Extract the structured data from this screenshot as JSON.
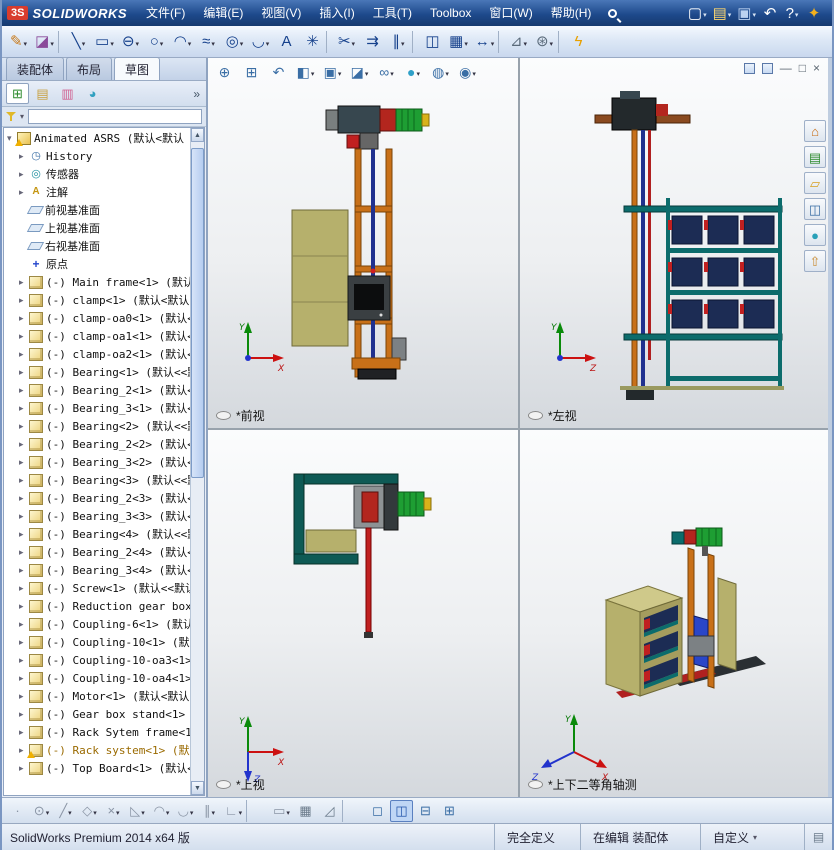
{
  "title_bar": {
    "logo_mark": "3S",
    "logo_text": "SOLIDWORKS",
    "menus": [
      {
        "name": "menu-file",
        "label": "文件(F)"
      },
      {
        "name": "menu-edit",
        "label": "编辑(E)"
      },
      {
        "name": "menu-view",
        "label": "视图(V)"
      },
      {
        "name": "menu-insert",
        "label": "插入(I)"
      },
      {
        "name": "menu-tools",
        "label": "工具(T)"
      },
      {
        "name": "menu-toolbox",
        "label": "Toolbox"
      },
      {
        "name": "menu-window",
        "label": "窗口(W)"
      },
      {
        "name": "menu-help",
        "label": "帮助(H)"
      }
    ],
    "icons": [
      {
        "name": "new-document-button",
        "glyph": "▢",
        "color": "#ffffff",
        "dd": true
      },
      {
        "name": "open-button",
        "glyph": "▤",
        "color": "#ffd870",
        "dd": true
      },
      {
        "name": "save-button",
        "glyph": "▣",
        "color": "#bcd2f0",
        "dd": true
      },
      {
        "name": "undo-button",
        "glyph": "↶",
        "color": "#ffffff"
      },
      {
        "name": "help-button",
        "glyph": "?",
        "color": "#ffffff",
        "dd": true
      },
      {
        "name": "resources-button",
        "glyph": "✦",
        "color": "#f2b01e"
      }
    ]
  },
  "main_toolbar": [
    {
      "name": "smart-dimension-button",
      "glyph": "✎",
      "color": "#c87a1a",
      "dd": true
    },
    {
      "name": "sketch-button",
      "glyph": "◪",
      "color": "#8a4a9a",
      "dd": true
    },
    {
      "sep": true
    },
    {
      "name": "line-button",
      "glyph": "╲",
      "color": "#16418c",
      "dd": true
    },
    {
      "name": "rectangle-button",
      "glyph": "▭",
      "color": "#16418c",
      "dd": true
    },
    {
      "name": "slot-button",
      "glyph": "⊖",
      "color": "#16418c",
      "dd": true
    },
    {
      "name": "circle-button",
      "glyph": "○",
      "color": "#16418c",
      "dd": true
    },
    {
      "name": "arc-button",
      "glyph": "◠",
      "color": "#16418c",
      "dd": true
    },
    {
      "name": "spline-button",
      "glyph": "≈",
      "color": "#16418c",
      "dd": true
    },
    {
      "name": "ellipse-button",
      "glyph": "◎",
      "color": "#16418c",
      "dd": true
    },
    {
      "name": "fillet-button",
      "glyph": "◡",
      "color": "#16418c",
      "dd": true
    },
    {
      "name": "text-button",
      "glyph": "A",
      "color": "#16418c"
    },
    {
      "name": "point-button",
      "glyph": "✳",
      "color": "#16418c"
    },
    {
      "sep": true
    },
    {
      "name": "trim-entities-button",
      "glyph": "✂",
      "color": "#16418c",
      "dd": true
    },
    {
      "name": "convert-entities-button",
      "glyph": "⇉",
      "color": "#16418c"
    },
    {
      "name": "offset-entities-button",
      "glyph": "∥",
      "color": "#16418c",
      "dd": true
    },
    {
      "sep": true
    },
    {
      "name": "mirror-entities-button",
      "glyph": "◫",
      "color": "#16418c"
    },
    {
      "name": "linear-pattern-button",
      "glyph": "▦",
      "color": "#16418c",
      "dd": true
    },
    {
      "name": "move-entities-button",
      "glyph": "↔",
      "color": "#16418c",
      "dd": true
    },
    {
      "sep": true
    },
    {
      "name": "display-relations-button",
      "glyph": "⊿",
      "color": "#5a6a7a",
      "dd": true
    },
    {
      "name": "quick-snaps-button",
      "glyph": "⊛",
      "color": "#5a6a7a",
      "dd": true
    },
    {
      "sep": true
    },
    {
      "name": "instant3d-button",
      "glyph": "ϟ",
      "color": "#e8a000"
    }
  ],
  "command_tabs": [
    {
      "name": "tab-assembly",
      "label": "装配体"
    },
    {
      "name": "tab-layout",
      "label": "布局"
    },
    {
      "name": "tab-sketch",
      "label": "草图",
      "active": true
    }
  ],
  "feature_manager": {
    "chevron": "»",
    "filter_arrow": "▾",
    "tabs": [
      {
        "name": "featuremanager-tree-tab",
        "glyph": "⊞",
        "color": "#2e8b2e",
        "active": true
      },
      {
        "name": "propertymanager-tab",
        "glyph": "▤",
        "color": "#c8a040"
      },
      {
        "name": "configurationmanager-tab",
        "glyph": "▥",
        "color": "#d06090"
      },
      {
        "name": "displaymanager-tab",
        "glyph": "◕",
        "color": "#30a0c0"
      }
    ]
  },
  "feature_tree": {
    "items": [
      {
        "icon": "assembly-icon",
        "label": "Animated ASRS (默认<默认",
        "e": "▾",
        "level": 0,
        "warning": true
      },
      {
        "icon": "history-icon",
        "label": "History",
        "e": "▸",
        "level": 1
      },
      {
        "icon": "sensors-icon",
        "label": "传感器",
        "e": "▸",
        "level": 1
      },
      {
        "icon": "annotations-icon",
        "label": "注解",
        "e": "▸",
        "level": 1
      },
      {
        "icon": "plane-icon",
        "label": "前视基准面",
        "e": "",
        "level": 1
      },
      {
        "icon": "plane-icon",
        "label": "上视基准面",
        "e": "",
        "level": 1
      },
      {
        "icon": "plane-icon",
        "label": "右视基准面",
        "e": "",
        "level": 1
      },
      {
        "icon": "origin-icon",
        "label": "原点",
        "e": "",
        "level": 1
      },
      {
        "icon": "part-icon",
        "label": "(-) Main frame<1> (默认<",
        "e": "▸",
        "level": 1
      },
      {
        "icon": "part-icon",
        "label": "(-) clamp<1> (默认<默认",
        "e": "▸",
        "level": 1
      },
      {
        "icon": "part-icon",
        "label": "(-) clamp-oa0<1> (默认<",
        "e": "▸",
        "level": 1
      },
      {
        "icon": "part-icon",
        "label": "(-) clamp-oa1<1> (默认<",
        "e": "▸",
        "level": 1
      },
      {
        "icon": "part-icon",
        "label": "(-) clamp-oa2<1> (默认<",
        "e": "▸",
        "level": 1
      },
      {
        "icon": "part-icon",
        "label": "(-) Bearing<1> (默认<<默",
        "e": "▸",
        "level": 1
      },
      {
        "icon": "part-icon",
        "label": "(-) Bearing_2<1> (默认<",
        "e": "▸",
        "level": 1
      },
      {
        "icon": "part-icon",
        "label": "(-) Bearing_3<1> (默认<",
        "e": "▸",
        "level": 1
      },
      {
        "icon": "part-icon",
        "label": "(-) Bearing<2> (默认<<默",
        "e": "▸",
        "level": 1
      },
      {
        "icon": "part-icon",
        "label": "(-) Bearing_2<2> (默认<",
        "e": "▸",
        "level": 1
      },
      {
        "icon": "part-icon",
        "label": "(-) Bearing_3<2> (默认<",
        "e": "▸",
        "level": 1
      },
      {
        "icon": "part-icon",
        "label": "(-) Bearing<3> (默认<<默",
        "e": "▸",
        "level": 1
      },
      {
        "icon": "part-icon",
        "label": "(-) Bearing_2<3> (默认<",
        "e": "▸",
        "level": 1
      },
      {
        "icon": "part-icon",
        "label": "(-) Bearing_3<3> (默认<",
        "e": "▸",
        "level": 1
      },
      {
        "icon": "part-icon",
        "label": "(-) Bearing<4> (默认<<默",
        "e": "▸",
        "level": 1
      },
      {
        "icon": "part-icon",
        "label": "(-) Bearing_2<4> (默认<",
        "e": "▸",
        "level": 1
      },
      {
        "icon": "part-icon",
        "label": "(-) Bearing_3<4> (默认<",
        "e": "▸",
        "level": 1
      },
      {
        "icon": "part-icon",
        "label": "(-) Screw<1> (默认<<默认",
        "e": "▸",
        "level": 1
      },
      {
        "icon": "part-icon",
        "label": "(-) Reduction gear box<1",
        "e": "▸",
        "level": 1
      },
      {
        "icon": "part-icon",
        "label": "(-) Coupling-6<1> (默认<",
        "e": "▸",
        "level": 1
      },
      {
        "icon": "part-icon",
        "label": "(-) Coupling-10<1> (默认",
        "e": "▸",
        "level": 1
      },
      {
        "icon": "part-icon",
        "label": "(-) Coupling-10-oa3<1> (",
        "e": "▸",
        "level": 1
      },
      {
        "icon": "part-icon",
        "label": "(-) Coupling-10-oa4<1> (",
        "e": "▸",
        "level": 1
      },
      {
        "icon": "part-icon",
        "label": "(-) Motor<1> (默认<默认",
        "e": "▸",
        "level": 1
      },
      {
        "icon": "part-icon",
        "label": "(-) Gear box stand<1> (默",
        "e": "▸",
        "level": 1
      },
      {
        "icon": "part-icon",
        "label": "(-) Rack Sytem frame<1> (",
        "e": "▸",
        "level": 1
      },
      {
        "icon": "part-icon",
        "label": "(-) Rack system<1> (默认",
        "e": "▸",
        "level": 1,
        "warning": true,
        "highlight": true
      },
      {
        "icon": "part-icon",
        "label": "(-) Top Board<1> (默认<默",
        "e": "▸",
        "level": 1
      }
    ]
  },
  "scrollbar": {
    "up": "▲",
    "down": "▼"
  },
  "hud_toolbar": [
    {
      "name": "zoom-fit-button",
      "glyph": "⊕",
      "color": "#3a6ea5"
    },
    {
      "name": "zoom-area-button",
      "glyph": "⊞",
      "color": "#3a6ea5"
    },
    {
      "name": "previous-view-button",
      "glyph": "↶",
      "color": "#3a6ea5"
    },
    {
      "name": "section-view-button",
      "glyph": "◧",
      "color": "#3a6ea5",
      "dd": true
    },
    {
      "name": "view-orientation-button",
      "glyph": "▣",
      "color": "#3a6ea5",
      "dd": true
    },
    {
      "name": "display-style-button",
      "glyph": "◪",
      "color": "#3a6ea5",
      "dd": true
    },
    {
      "name": "hide-show-items-button",
      "glyph": "∞",
      "color": "#3a6ea5",
      "dd": true
    },
    {
      "name": "edit-appearance-button",
      "glyph": "●",
      "color": "#2fa0c8",
      "dd": true
    },
    {
      "name": "apply-scene-button",
      "glyph": "◍",
      "color": "#3a6ea5",
      "dd": true
    },
    {
      "name": "view-settings-button",
      "glyph": "◉",
      "color": "#3a6ea5",
      "dd": true
    }
  ],
  "window_controls": {
    "minimize": "—",
    "restore": "□",
    "close": "×"
  },
  "task_pane": [
    {
      "name": "solidworks-resources-tab",
      "glyph": "⌂",
      "color": "#c86a10"
    },
    {
      "name": "design-library-tab",
      "glyph": "▤",
      "color": "#2e8b2e"
    },
    {
      "name": "file-explorer-tab",
      "glyph": "▱",
      "color": "#d8a020"
    },
    {
      "name": "view-palette-tab",
      "glyph": "◫",
      "color": "#3a6ea5"
    },
    {
      "name": "appearances-tab",
      "glyph": "●",
      "color": "#28a0b8"
    },
    {
      "name": "custom-properties-tab",
      "glyph": "⇧",
      "color": "#c88a30"
    }
  ],
  "viewports": {
    "front": {
      "label": "*前视",
      "triad": {
        "up": "Y",
        "right": "X"
      }
    },
    "left": {
      "label": "*左视",
      "triad": {
        "up": "Y",
        "right": "Z"
      }
    },
    "top": {
      "label": "*上视",
      "triad": {
        "up": "Y",
        "right": "X",
        "down": "Z"
      }
    },
    "iso": {
      "label": "*上下二等角轴测",
      "triad": {
        "up": "Y",
        "right": "X",
        "left": "Z"
      }
    }
  },
  "bottom_toolbar": [
    {
      "name": "sketch-point-button",
      "glyph": "·",
      "color": "#8a95a5"
    },
    {
      "name": "circle-snap-button",
      "glyph": "⊙",
      "color": "#8a95a5",
      "dd": true
    },
    {
      "name": "line-snap-button",
      "glyph": "╱",
      "color": "#8a95a5",
      "dd": true
    },
    {
      "name": "polygon-snap-button",
      "glyph": "◇",
      "color": "#8a95a5",
      "dd": true
    },
    {
      "name": "intersection-snap-button",
      "glyph": "×",
      "color": "#8a95a5",
      "dd": true
    },
    {
      "name": "angle-snap-button",
      "glyph": "◺",
      "color": "#8a95a5",
      "dd": true
    },
    {
      "name": "arc-snap-button",
      "glyph": "◠",
      "color": "#8a95a5",
      "dd": true
    },
    {
      "name": "tangent-snap-button",
      "glyph": "◡",
      "color": "#8a95a5",
      "dd": true
    },
    {
      "name": "parallel-snap-button",
      "glyph": "∥",
      "color": "#8a95a5",
      "dd": true
    },
    {
      "name": "corner-snap-button",
      "glyph": "∟",
      "color": "#8a95a5",
      "dd": true
    },
    {
      "sep": true
    },
    {
      "name": "ruler-button",
      "glyph": "▭",
      "color": "#8a95a5",
      "dd": true
    },
    {
      "name": "grid-button",
      "glyph": "▦",
      "color": "#6a7a8a"
    },
    {
      "name": "angle-button",
      "glyph": "◿",
      "color": "#6a7a8a"
    },
    {
      "sep": true
    },
    {
      "name": "single-view-button",
      "glyph": "◻",
      "color": "#3a6ea5"
    },
    {
      "name": "four-view-button",
      "glyph": "◫",
      "color": "#2255aa",
      "selected": true
    },
    {
      "name": "two-view-horizontal-button",
      "glyph": "⊟",
      "color": "#3a6ea5"
    },
    {
      "name": "two-view-vertical-button",
      "glyph": "⊞",
      "color": "#3a6ea5"
    }
  ],
  "statusbar": {
    "product": "SolidWorks Premium 2014 x64 版",
    "defined": "完全定义",
    "editing": "在编辑 装配体",
    "custom": "自定义",
    "icon": "▤"
  }
}
